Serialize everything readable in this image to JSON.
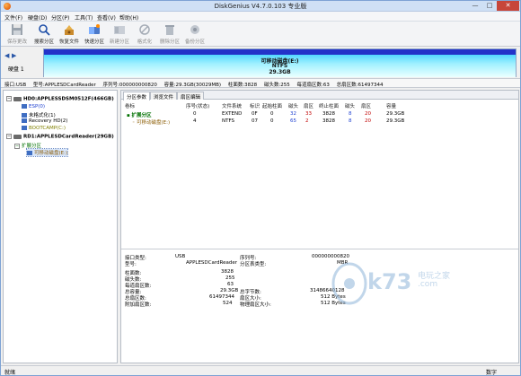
{
  "window": {
    "title": "DiskGenius V4.7.0.103 专业版",
    "minimize": "—",
    "maximize": "□",
    "close": "✕"
  },
  "menu": [
    "文件(F)",
    "硬盘(D)",
    "分区(P)",
    "工具(T)",
    "查看(V)",
    "帮助(H)"
  ],
  "toolbar": [
    {
      "label": "保存更改",
      "icon": "save-icon",
      "enabled": false
    },
    {
      "label": "搜索分区",
      "icon": "search-icon",
      "enabled": true
    },
    {
      "label": "恢复文件",
      "icon": "recover-icon",
      "enabled": true
    },
    {
      "label": "快速分区",
      "icon": "quick-partition-icon",
      "enabled": true
    },
    {
      "label": "新建分区",
      "icon": "new-partition-icon",
      "enabled": false
    },
    {
      "label": "格式化",
      "icon": "format-icon",
      "enabled": false
    },
    {
      "label": "删除分区",
      "icon": "delete-icon",
      "enabled": false
    },
    {
      "label": "备份分区",
      "icon": "backup-icon",
      "enabled": false
    }
  ],
  "diskmap": {
    "nav_prev": "◀",
    "nav_next": "▶",
    "disk_label": "硬盘 1",
    "partition_name": "可移动磁盘(E:)",
    "partition_fs": "NTFS",
    "partition_size": "29.3GB"
  },
  "infoline": [
    "接口:USB",
    "型号:APPLESDCardReader",
    "序列号:000000000820",
    "容量:29.3GB(30029MB)",
    "柱面数:3828",
    "磁头数:255",
    "每道扇区数:63",
    "总扇区数:61497344"
  ],
  "tree": {
    "disk0": "HD0:APPLESSDSM0512F(466GB)",
    "disk0_parts": [
      "ESP(0)",
      "未格式化(1)",
      "Recovery HD(2)",
      "BOOTCAMP(C:)"
    ],
    "disk1": "RD1:APPLESDCardReader(29GB)",
    "disk1_ext": "扩展分区",
    "disk1_part": "可移动磁盘(E:)"
  },
  "tabs": [
    "分区参数",
    "浏览文件",
    "扇区编辑"
  ],
  "table": {
    "headers": [
      "卷标",
      "序号(状态)",
      "文件系统",
      "标识",
      "起始柱面",
      "磁头",
      "扇区",
      "终止柱面",
      "磁头",
      "扇区",
      "容量"
    ],
    "rows": [
      {
        "label": "扩展分区",
        "index": "0",
        "fs": "EXTEND",
        "id": "0F",
        "start_cyl": "0",
        "head": "32",
        "sector": "33",
        "end_cyl": "3828",
        "end_head": "8",
        "end_sector": "20",
        "size": "29.3GB"
      },
      {
        "label": "可移动磁盘(E:)",
        "index": "4",
        "fs": "NTFS",
        "id": "07",
        "start_cyl": "0",
        "head": "65",
        "sector": "2",
        "end_cyl": "3828",
        "end_head": "8",
        "end_sector": "20",
        "size": "29.3GB"
      }
    ]
  },
  "details": {
    "interface_label": "接口类型:",
    "interface_value": "USB",
    "model_label": "型号:",
    "model_value": "APPLESDCardReader",
    "serial_label": "序列号:",
    "serial_value": "000000000820",
    "ptype_label": "分区表类型:",
    "ptype_value": "MBR",
    "cyl_label": "柱面数:",
    "cyl_value": "3828",
    "heads_label": "磁头数:",
    "heads_value": "255",
    "spt_label": "每道扇区数:",
    "spt_value": "63",
    "capacity_label": "总容量:",
    "capacity_value": "29.3GB",
    "total_sectors_label": "总扇区数:",
    "total_sectors_value": "61497344",
    "extra_sectors_label": "附加扇区数:",
    "extra_sectors_value": "524",
    "total_bytes_label": "总字节数:",
    "total_bytes_value": "31486640128",
    "sector_size_label": "扇区大小:",
    "sector_size_value": "512 Bytes",
    "phys_sector_label": "物理扇区大小:",
    "phys_sector_value": "512 Bytes"
  },
  "watermark": {
    "brand": "k73",
    "sub": "电玩之家",
    "domain": ".com"
  },
  "status": {
    "left": "就绪",
    "right": "数字"
  }
}
